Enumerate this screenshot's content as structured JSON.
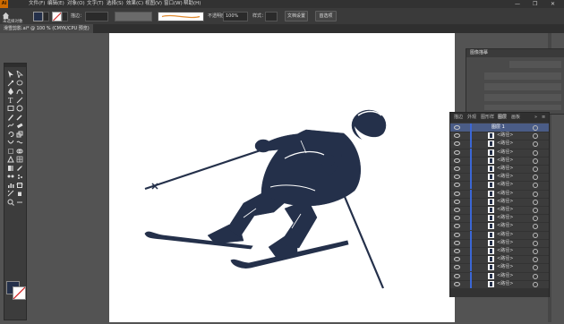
{
  "menu": {
    "logo": "Ai",
    "items": [
      "文件(F)",
      "编辑(E)",
      "对象(O)",
      "文字(T)",
      "选择(S)",
      "效果(C)",
      "视图(V)",
      "窗口(W)",
      "帮助(H)"
    ],
    "window_controls": [
      "—",
      "❐",
      "✕"
    ]
  },
  "control_bar": {
    "selection_label": "未选择对象",
    "stroke_label": "描边：",
    "opacity_label": "不透明度：",
    "opacity_value": "100%",
    "style_label": "样式：",
    "doc_setup_button": "文档设置",
    "preferences_button": "首选项"
  },
  "document_tab": {
    "title": "滑雪剪影.ai* @ 100 % (CMYK/CPU 预览)"
  },
  "right_panel": {
    "title": "图像描摹"
  },
  "layers_panel": {
    "tabs": [
      "描边",
      "外观",
      "图形样",
      "图层",
      "画板"
    ],
    "active_tab": "图层",
    "top_layer": "图层 1",
    "sublayer_label": "<路径>",
    "sublayer_count": 20
  },
  "colors": {
    "artwork": "#24304a",
    "accent": "#3b67d6",
    "logo": "#cc6a00"
  },
  "icons": {
    "home": "home-icon",
    "collapse": "double-arrow-icon",
    "menu": "panel-menu-icon"
  }
}
